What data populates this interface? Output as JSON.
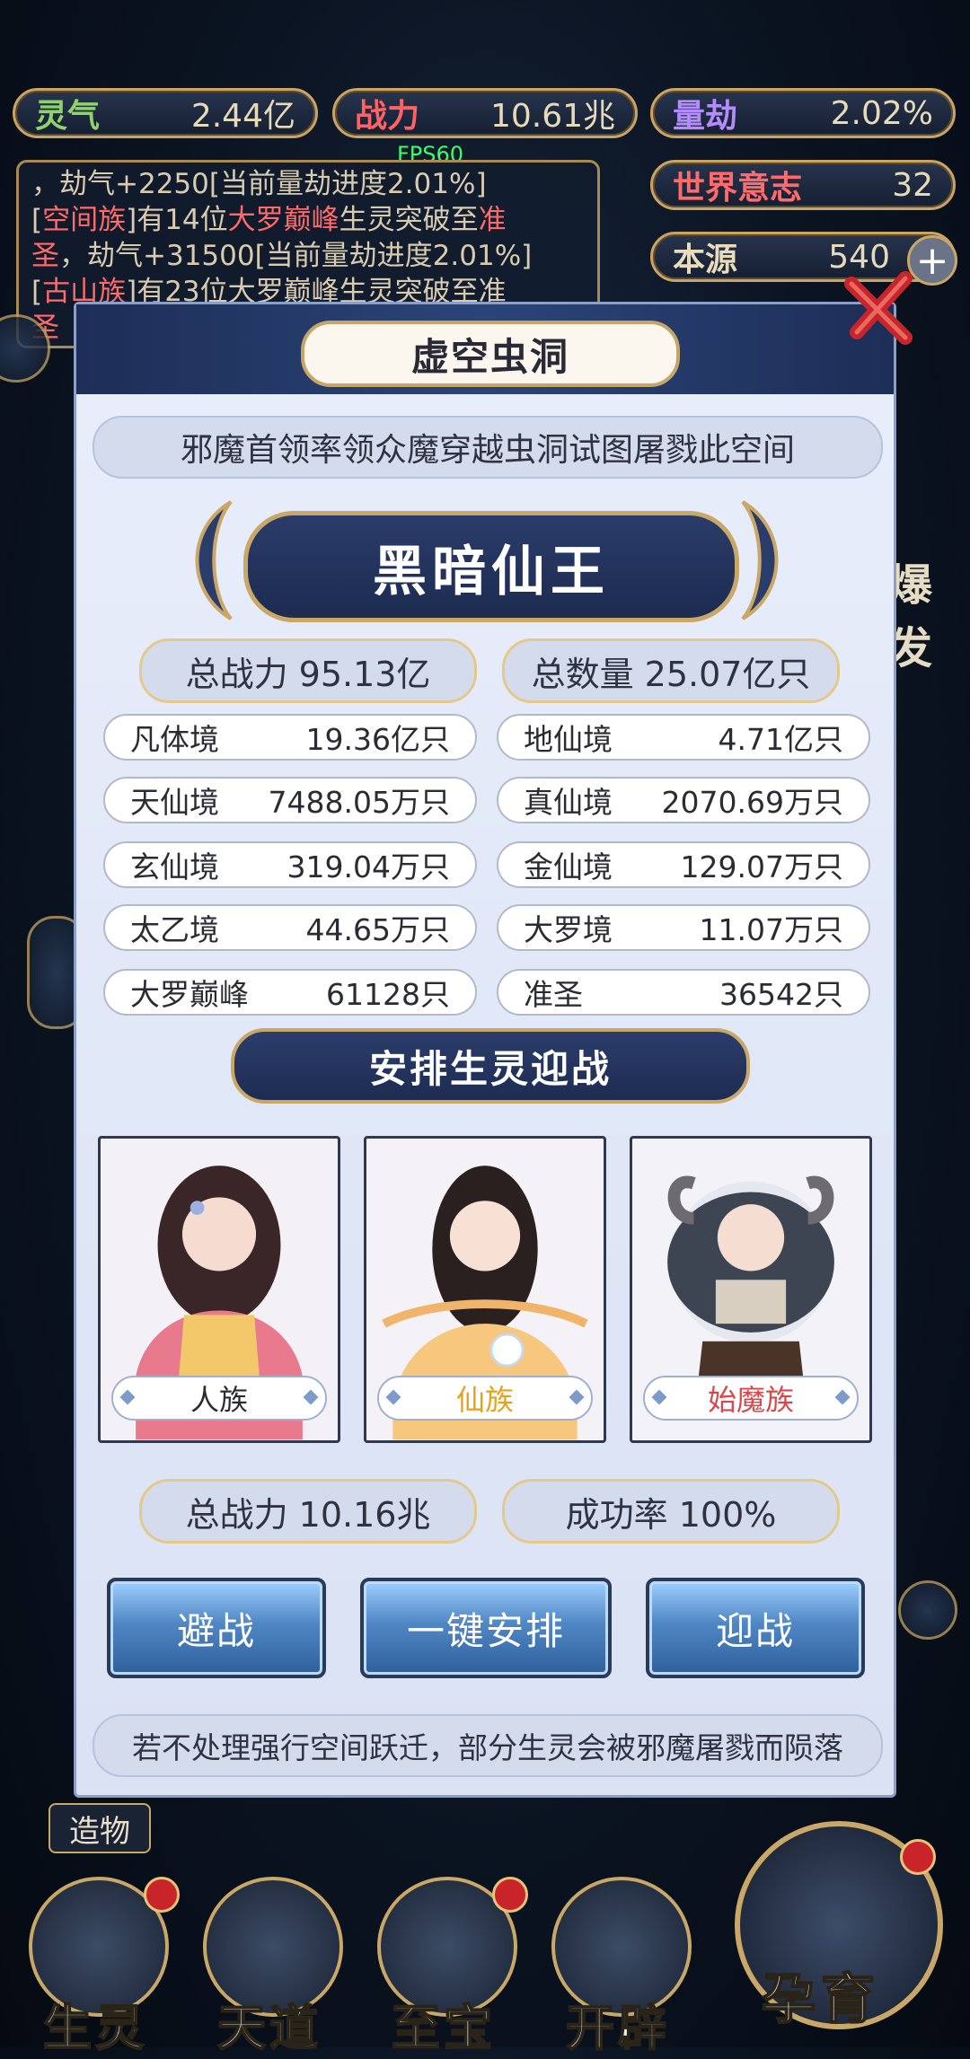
{
  "hud": {
    "lingqi": {
      "label": "灵气",
      "value": "2.44亿"
    },
    "zhanli": {
      "label": "战力",
      "value": "10.61兆"
    },
    "liangjie": {
      "label": "量劫",
      "value": "2.02%"
    },
    "shijie": {
      "label": "世界意志",
      "value": "32"
    },
    "benyuan": {
      "label": "本源",
      "value": "540"
    },
    "fps": "FPS60"
  },
  "log": {
    "line1": "，劫气+2250[当前量劫进度2.01%]",
    "line2_a": "[",
    "line2_b": "空间族",
    "line2_c": "]有14位",
    "line2_d": "大罗巅峰",
    "line2_e": "生灵突破至",
    "line2_f": "准",
    "line3_a": "圣",
    "line3_b": "，劫气+31500[当前量劫进度2.01%]",
    "line4_a": "[",
    "line4_b": "古山族",
    "line4_c": "]有23位大罗巅峰生灵突破至准",
    "line5": "圣"
  },
  "modal": {
    "title": "虚空虫洞",
    "description": "邪魔首领率领众魔穿越虫洞试图屠戮此空间",
    "boss_name": "黑暗仙王",
    "total_power": "总战力 95.13亿",
    "total_count": "总数量 25.07亿只",
    "realms": [
      {
        "name": "凡体境",
        "value": "19.36亿只"
      },
      {
        "name": "地仙境",
        "value": "4.71亿只"
      },
      {
        "name": "天仙境",
        "value": "7488.05万只"
      },
      {
        "name": "真仙境",
        "value": "2070.69万只"
      },
      {
        "name": "玄仙境",
        "value": "319.04万只"
      },
      {
        "name": "金仙境",
        "value": "129.07万只"
      },
      {
        "name": "太乙境",
        "value": "44.65万只"
      },
      {
        "name": "大罗境",
        "value": "11.07万只"
      },
      {
        "name": "大罗巅峰",
        "value": "61128只"
      },
      {
        "name": "准圣",
        "value": "36542只"
      }
    ],
    "section_title": "安排生灵迎战",
    "cards": [
      {
        "race": "人族",
        "color": "#2b2b33"
      },
      {
        "race": "仙族",
        "color": "#e6a21a"
      },
      {
        "race": "始魔族",
        "color": "#d9474a"
      }
    ],
    "our_power": "总战力 10.16兆",
    "success_rate": "成功率 100%",
    "buttons": {
      "avoid": "避战",
      "auto": "一键安排",
      "fight": "迎战"
    },
    "footer": "若不处理强行空间跃迁，部分生灵会被邪魔屠戮而陨落"
  },
  "side": {
    "baofa": "爆发",
    "zaowu": "造物"
  },
  "nav": {
    "shengling": "生灵",
    "tiandao": "天道",
    "zhibao": "至宝",
    "kaipi": "开辟",
    "yunyu": "孕育"
  }
}
